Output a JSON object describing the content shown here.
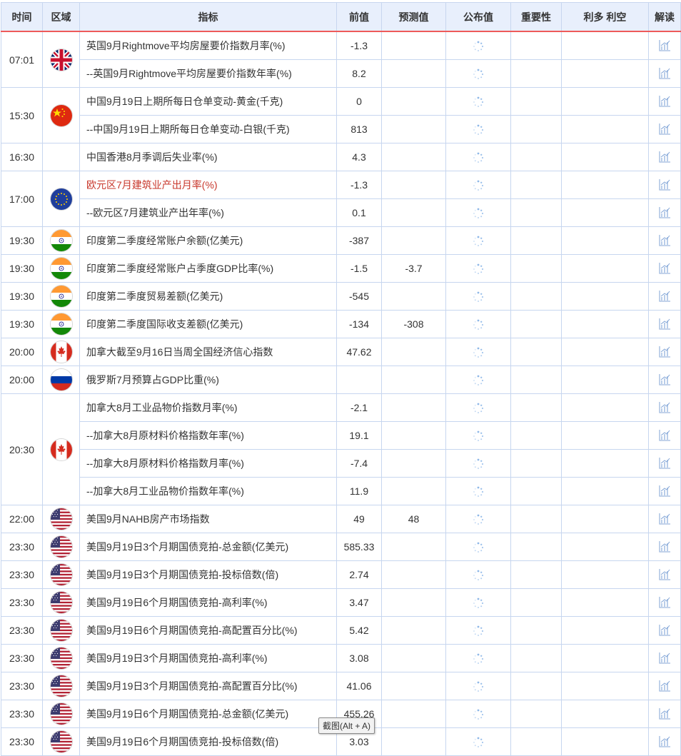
{
  "headers": {
    "time": "时间",
    "region": "区域",
    "indicator": "指标",
    "previous": "前值",
    "forecast": "预测值",
    "actual": "公布值",
    "importance": "重要性",
    "impact": "利多 利空",
    "analysis": "解读"
  },
  "groups": [
    {
      "time": "07:01",
      "flag": "uk-flag-icon",
      "rows": [
        {
          "indicator": "英国9月Rightmove平均房屋要价指数月率(%)",
          "previous": "-1.3",
          "forecast": ""
        },
        {
          "indicator": "--英国9月Rightmove平均房屋要价指数年率(%)",
          "previous": "8.2",
          "forecast": ""
        }
      ]
    },
    {
      "time": "15:30",
      "flag": "china-flag-icon",
      "rows": [
        {
          "indicator": "中国9月19日上期所每日仓单变动-黄金(千克)",
          "previous": "0",
          "forecast": ""
        },
        {
          "indicator": "--中国9月19日上期所每日仓单变动-白银(千克)",
          "previous": "813",
          "forecast": ""
        }
      ]
    },
    {
      "time": "16:30",
      "flag": "",
      "rows": [
        {
          "indicator": "中国香港8月季调后失业率(%)",
          "previous": "4.3",
          "forecast": ""
        }
      ]
    },
    {
      "time": "17:00",
      "flag": "eu-flag-icon",
      "rows": [
        {
          "indicator": "欧元区7月建筑业产出月率(%)",
          "previous": "-1.3",
          "forecast": "",
          "highlight": "#c8372b"
        },
        {
          "indicator": "--欧元区7月建筑业产出年率(%)",
          "previous": "0.1",
          "forecast": ""
        }
      ]
    },
    {
      "time": "19:30",
      "flag": "india-flag-icon",
      "rows": [
        {
          "indicator": "印度第二季度经常账户余额(亿美元)",
          "previous": "-387",
          "forecast": ""
        }
      ]
    },
    {
      "time": "19:30",
      "flag": "india-flag-icon",
      "rows": [
        {
          "indicator": "印度第二季度经常账户占季度GDP比率(%)",
          "previous": "-1.5",
          "forecast": "-3.7"
        }
      ]
    },
    {
      "time": "19:30",
      "flag": "india-flag-icon",
      "rows": [
        {
          "indicator": "印度第二季度贸易差额(亿美元)",
          "previous": "-545",
          "forecast": ""
        }
      ]
    },
    {
      "time": "19:30",
      "flag": "india-flag-icon",
      "rows": [
        {
          "indicator": "印度第二季度国际收支差额(亿美元)",
          "previous": "-134",
          "forecast": "-308"
        }
      ]
    },
    {
      "time": "20:00",
      "flag": "canada-flag-icon",
      "rows": [
        {
          "indicator": "加拿大截至9月16日当周全国经济信心指数",
          "previous": "47.62",
          "forecast": ""
        }
      ]
    },
    {
      "time": "20:00",
      "flag": "russia-flag-icon",
      "rows": [
        {
          "indicator": "俄罗斯7月预算占GDP比重(%)",
          "previous": "",
          "forecast": ""
        }
      ]
    },
    {
      "time": "20:30",
      "flag": "canada-flag-icon",
      "rows": [
        {
          "indicator": "加拿大8月工业品物价指数月率(%)",
          "previous": "-2.1",
          "forecast": ""
        },
        {
          "indicator": "--加拿大8月原材料价格指数年率(%)",
          "previous": "19.1",
          "forecast": ""
        },
        {
          "indicator": "--加拿大8月原材料价格指数月率(%)",
          "previous": "-7.4",
          "forecast": ""
        },
        {
          "indicator": "--加拿大8月工业品物价指数年率(%)",
          "previous": "11.9",
          "forecast": ""
        }
      ]
    },
    {
      "time": "22:00",
      "flag": "usa-flag-icon",
      "rows": [
        {
          "indicator": "美国9月NAHB房产市场指数",
          "previous": "49",
          "forecast": "48"
        }
      ]
    },
    {
      "time": "23:30",
      "flag": "usa-flag-icon",
      "rows": [
        {
          "indicator": "美国9月19日3个月期国债竞拍-总金额(亿美元)",
          "previous": "585.33",
          "forecast": ""
        }
      ]
    },
    {
      "time": "23:30",
      "flag": "usa-flag-icon",
      "rows": [
        {
          "indicator": "美国9月19日3个月期国债竞拍-投标倍数(倍)",
          "previous": "2.74",
          "forecast": ""
        }
      ]
    },
    {
      "time": "23:30",
      "flag": "usa-flag-icon",
      "rows": [
        {
          "indicator": "美国9月19日6个月期国债竞拍-高利率(%)",
          "previous": "3.47",
          "forecast": ""
        }
      ]
    },
    {
      "time": "23:30",
      "flag": "usa-flag-icon",
      "rows": [
        {
          "indicator": "美国9月19日6个月期国债竞拍-高配置百分比(%)",
          "previous": "5.42",
          "forecast": ""
        }
      ]
    },
    {
      "time": "23:30",
      "flag": "usa-flag-icon",
      "rows": [
        {
          "indicator": "美国9月19日3个月期国债竞拍-高利率(%)",
          "previous": "3.08",
          "forecast": ""
        }
      ]
    },
    {
      "time": "23:30",
      "flag": "usa-flag-icon",
      "rows": [
        {
          "indicator": "美国9月19日3个月期国债竞拍-高配置百分比(%)",
          "previous": "41.06",
          "forecast": ""
        }
      ]
    },
    {
      "time": "23:30",
      "flag": "usa-flag-icon",
      "rows": [
        {
          "indicator": "美国9月19日6个月期国债竞拍-总金额(亿美元)",
          "previous": "455.26",
          "forecast": ""
        }
      ]
    },
    {
      "time": "23:30",
      "flag": "usa-flag-icon",
      "rows": [
        {
          "indicator": "美国9月19日6个月期国债竞拍-投标倍数(倍)",
          "previous": "3.03",
          "forecast": ""
        }
      ]
    }
  ],
  "actual_icon": "loading-spinner-icon",
  "analysis_icon": "chart-analysis-icon",
  "tooltip": "截图(Alt + A)",
  "colors": {
    "header_bg": "#e8effc",
    "header_underline": "#ee5a5a",
    "border": "#c7d6ef",
    "highlight_text": "#c8372b"
  }
}
